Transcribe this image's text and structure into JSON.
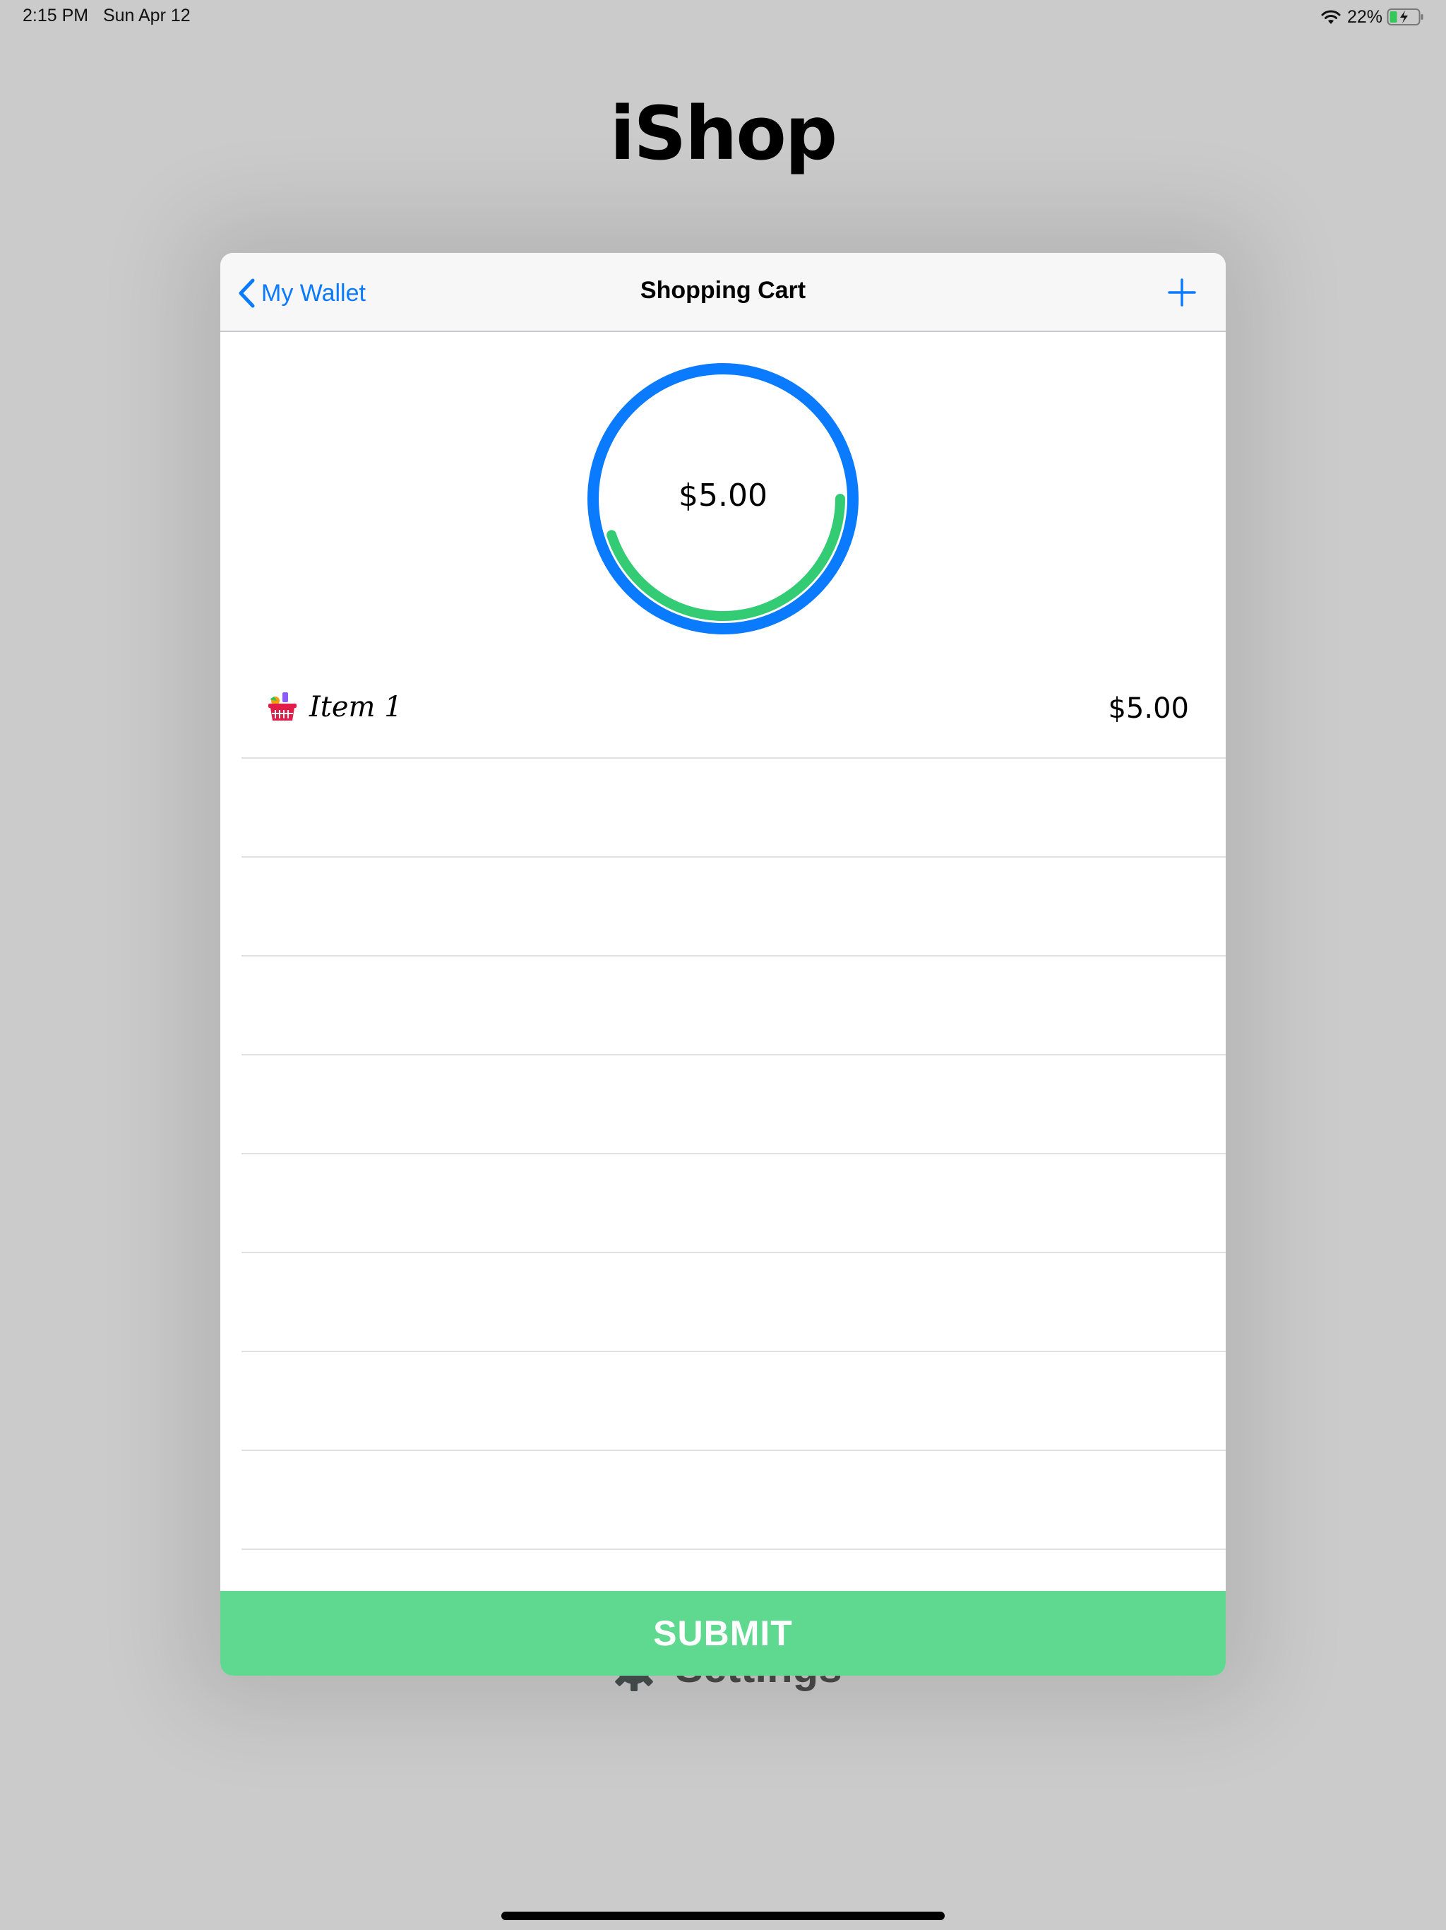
{
  "status_bar": {
    "time": "2:15 PM   Sun Apr 12",
    "battery_percent": "22%"
  },
  "background": {
    "app_title": "iShop",
    "settings_label": "Settings"
  },
  "modal": {
    "nav": {
      "back_label": "My Wallet",
      "title": "Shopping Cart"
    },
    "gauge": {
      "value_text": "$5.00",
      "spent_fraction": 0.45,
      "ring_color": "#0a7aff",
      "progress_color": "#33cc75"
    },
    "items": [
      {
        "name": "Item 1",
        "price": "$5.00",
        "icon": "shopping-basket-icon"
      }
    ],
    "submit_label": "SUBMIT"
  },
  "colors": {
    "accent": "#0a7aff",
    "submit": "#5ed98f",
    "background": "#cbcbcb"
  }
}
